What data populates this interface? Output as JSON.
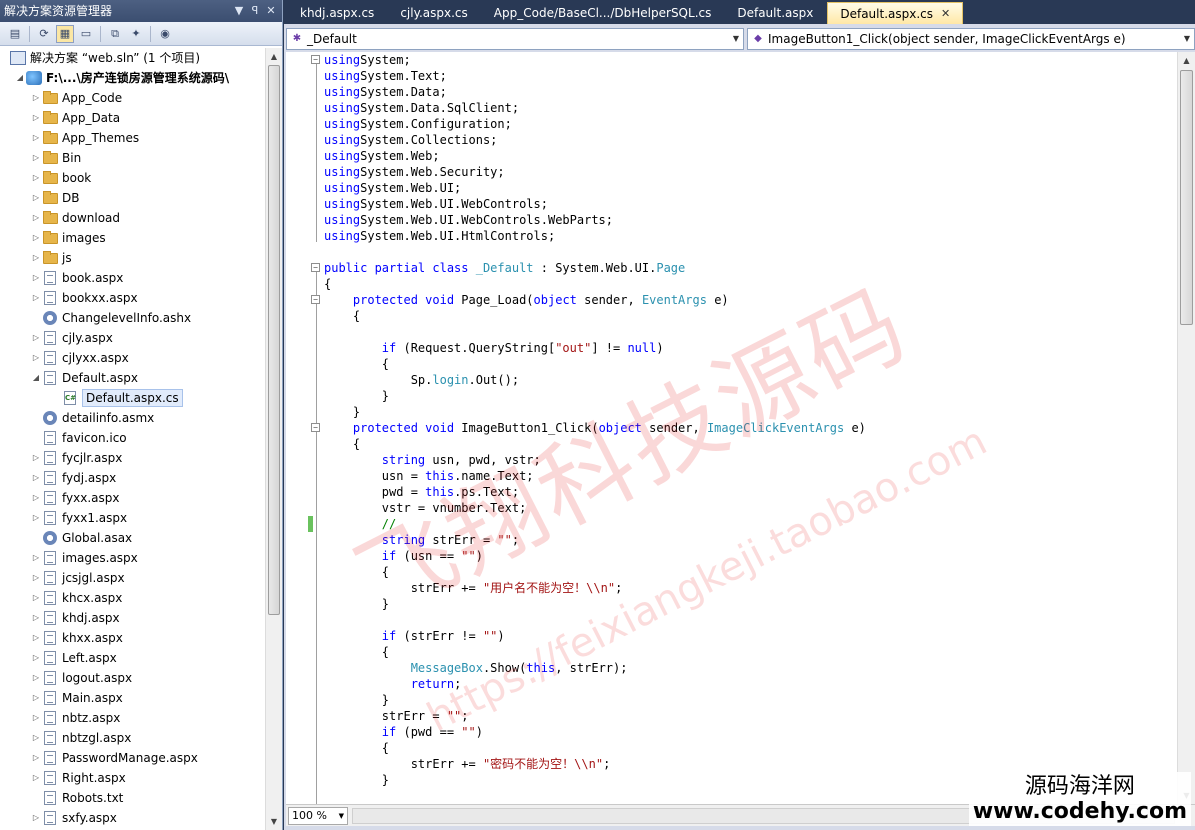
{
  "solution_explorer": {
    "title": "解决方案资源管理器",
    "title_buttons": [
      "▼",
      "ꟼ",
      "✕"
    ],
    "toolbar_icons": [
      "properties-icon",
      "refresh-icon",
      "show-all-files-icon",
      "view-code-icon",
      "copy-website-icon",
      "aspnet-config-icon",
      "class-diagram-icon"
    ],
    "solution_label": "解决方案 “web.sln” (1 个项目)",
    "project_label": "F:\\...\\房产连锁房源管理系统源码\\",
    "items": [
      {
        "label": "App_Code",
        "type": "folder",
        "arrow": "▷"
      },
      {
        "label": "App_Data",
        "type": "folder",
        "arrow": "▷"
      },
      {
        "label": "App_Themes",
        "type": "folder",
        "arrow": "▷"
      },
      {
        "label": "Bin",
        "type": "folder",
        "arrow": "▷"
      },
      {
        "label": "book",
        "type": "folder",
        "arrow": "▷"
      },
      {
        "label": "DB",
        "type": "folder",
        "arrow": "▷"
      },
      {
        "label": "download",
        "type": "folder",
        "arrow": "▷"
      },
      {
        "label": "images",
        "type": "folder",
        "arrow": "▷"
      },
      {
        "label": "js",
        "type": "folder",
        "arrow": "▷"
      },
      {
        "label": "book.aspx",
        "type": "page",
        "arrow": "▷"
      },
      {
        "label": "bookxx.aspx",
        "type": "page",
        "arrow": "▷"
      },
      {
        "label": "ChangelevelInfo.ashx",
        "type": "handler",
        "arrow": ""
      },
      {
        "label": "cjly.aspx",
        "type": "page",
        "arrow": "▷"
      },
      {
        "label": "cjlyxx.aspx",
        "type": "page",
        "arrow": "▷"
      },
      {
        "label": "Default.aspx",
        "type": "page",
        "arrow": "◢"
      },
      {
        "label": "Default.aspx.cs",
        "type": "cs",
        "arrow": "",
        "selected": true,
        "child": true
      },
      {
        "label": "detailinfo.asmx",
        "type": "handler",
        "arrow": ""
      },
      {
        "label": "favicon.ico",
        "type": "page",
        "arrow": ""
      },
      {
        "label": "fycjlr.aspx",
        "type": "page",
        "arrow": "▷"
      },
      {
        "label": "fydj.aspx",
        "type": "page",
        "arrow": "▷"
      },
      {
        "label": "fyxx.aspx",
        "type": "page",
        "arrow": "▷"
      },
      {
        "label": "fyxx1.aspx",
        "type": "page",
        "arrow": "▷"
      },
      {
        "label": "Global.asax",
        "type": "handler",
        "arrow": ""
      },
      {
        "label": "images.aspx",
        "type": "page",
        "arrow": "▷"
      },
      {
        "label": "jcsjgl.aspx",
        "type": "page",
        "arrow": "▷"
      },
      {
        "label": "khcx.aspx",
        "type": "page",
        "arrow": "▷"
      },
      {
        "label": "khdj.aspx",
        "type": "page",
        "arrow": "▷"
      },
      {
        "label": "khxx.aspx",
        "type": "page",
        "arrow": "▷"
      },
      {
        "label": "Left.aspx",
        "type": "page",
        "arrow": "▷"
      },
      {
        "label": "logout.aspx",
        "type": "page",
        "arrow": "▷"
      },
      {
        "label": "Main.aspx",
        "type": "page",
        "arrow": "▷"
      },
      {
        "label": "nbtz.aspx",
        "type": "page",
        "arrow": "▷"
      },
      {
        "label": "nbtzgl.aspx",
        "type": "page",
        "arrow": "▷"
      },
      {
        "label": "PasswordManage.aspx",
        "type": "page",
        "arrow": "▷"
      },
      {
        "label": "Right.aspx",
        "type": "page",
        "arrow": "▷"
      },
      {
        "label": "Robots.txt",
        "type": "page",
        "arrow": ""
      },
      {
        "label": "sxfy.aspx",
        "type": "page",
        "arrow": "▷"
      }
    ]
  },
  "editor": {
    "tabs": [
      {
        "label": "khdj.aspx.cs",
        "active": false
      },
      {
        "label": "cjly.aspx.cs",
        "active": false
      },
      {
        "label": "App_Code/BaseCl.../DbHelperSQL.cs",
        "active": false
      },
      {
        "label": "Default.aspx",
        "active": false
      },
      {
        "label": "Default.aspx.cs",
        "active": true
      }
    ],
    "class_combo": "_Default",
    "member_combo": "ImageButton1_Click(object sender, ImageClickEventArgs e)",
    "zoom": "100 %",
    "code_lines": [
      [
        [
          "kw",
          "using"
        ],
        [
          "",
          "System;"
        ]
      ],
      [
        [
          "kw",
          "using"
        ],
        [
          "",
          "System.Text;"
        ]
      ],
      [
        [
          "kw",
          "using"
        ],
        [
          "",
          "System.Data;"
        ]
      ],
      [
        [
          "kw",
          "using"
        ],
        [
          "",
          "System.Data.SqlClient;"
        ]
      ],
      [
        [
          "kw",
          "using"
        ],
        [
          "",
          "System.Configuration;"
        ]
      ],
      [
        [
          "kw",
          "using"
        ],
        [
          "",
          "System.Collections;"
        ]
      ],
      [
        [
          "kw",
          "using"
        ],
        [
          "",
          "System.Web;"
        ]
      ],
      [
        [
          "kw",
          "using"
        ],
        [
          "",
          "System.Web.Security;"
        ]
      ],
      [
        [
          "kw",
          "using"
        ],
        [
          "",
          "System.Web.UI;"
        ]
      ],
      [
        [
          "kw",
          "using"
        ],
        [
          "",
          "System.Web.UI.WebControls;"
        ]
      ],
      [
        [
          "kw",
          "using"
        ],
        [
          "",
          "System.Web.UI.WebControls.WebParts;"
        ]
      ],
      [
        [
          "kw",
          "using"
        ],
        [
          "",
          "System.Web.UI.HtmlControls;"
        ]
      ],
      [],
      [
        [
          "kw",
          "public partial class"
        ],
        [
          "",
          ""
        ],
        [
          "ty",
          "_Default"
        ],
        [
          "",
          " : System.Web.UI."
        ],
        [
          "ty",
          "Page"
        ]
      ],
      [
        [
          "",
          "{"
        ]
      ],
      [
        [
          "",
          "    "
        ],
        [
          "kw",
          "protected void"
        ],
        [
          "",
          " Page_Load("
        ],
        [
          "kw",
          "object"
        ],
        [
          "",
          " sender, "
        ],
        [
          "ty",
          "EventArgs"
        ],
        [
          "",
          " e)"
        ]
      ],
      [
        [
          "",
          "    {"
        ]
      ],
      [],
      [
        [
          "",
          "        "
        ],
        [
          "kw",
          "if"
        ],
        [
          "",
          " (Request.QueryString["
        ],
        [
          "st",
          "\"out\""
        ],
        [
          "",
          "] != "
        ],
        [
          "kw",
          "null"
        ],
        [
          "",
          ")"
        ]
      ],
      [
        [
          "",
          "        {"
        ]
      ],
      [
        [
          "",
          "            Sp."
        ],
        [
          "ty",
          "login"
        ],
        [
          "",
          ".Out();"
        ]
      ],
      [
        [
          "",
          "        }"
        ]
      ],
      [
        [
          "",
          "    }"
        ]
      ],
      [
        [
          "",
          "    "
        ],
        [
          "kw",
          "protected void"
        ],
        [
          "",
          " ImageButton1_Click("
        ],
        [
          "kw",
          "object"
        ],
        [
          "",
          " sender, "
        ],
        [
          "ty",
          "ImageClickEventArgs"
        ],
        [
          "",
          " e)"
        ]
      ],
      [
        [
          "",
          "    {"
        ]
      ],
      [
        [
          "",
          "        "
        ],
        [
          "kw",
          "string"
        ],
        [
          "",
          " usn, pwd, vstr;"
        ]
      ],
      [
        [
          "",
          "        usn = "
        ],
        [
          "kw",
          "this"
        ],
        [
          "",
          ".name.Text;"
        ]
      ],
      [
        [
          "",
          "        pwd = "
        ],
        [
          "kw",
          "this"
        ],
        [
          "",
          ".ps.Text;"
        ]
      ],
      [
        [
          "",
          "        vstr = vnumber.Text;"
        ]
      ],
      [
        [
          "",
          "        "
        ],
        [
          "cm",
          "//"
        ]
      ],
      [
        [
          "",
          "        "
        ],
        [
          "kw",
          "string"
        ],
        [
          "",
          " strErr = "
        ],
        [
          "st",
          "\"\""
        ],
        [
          "",
          ";"
        ]
      ],
      [
        [
          "",
          "        "
        ],
        [
          "kw",
          "if"
        ],
        [
          "",
          " (usn == "
        ],
        [
          "st",
          "\"\""
        ],
        [
          "",
          ")"
        ]
      ],
      [
        [
          "",
          "        {"
        ]
      ],
      [
        [
          "",
          "            strErr += "
        ],
        [
          "st",
          "\"用户名不能为空！\\\\n\""
        ],
        [
          "",
          ";"
        ]
      ],
      [
        [
          "",
          "        }"
        ]
      ],
      [],
      [
        [
          "",
          "        "
        ],
        [
          "kw",
          "if"
        ],
        [
          "",
          " (strErr != "
        ],
        [
          "st",
          "\"\""
        ],
        [
          "",
          ")"
        ]
      ],
      [
        [
          "",
          "        {"
        ]
      ],
      [
        [
          "",
          "            "
        ],
        [
          "ty",
          "MessageBox"
        ],
        [
          "",
          ".Show("
        ],
        [
          "kw",
          "this"
        ],
        [
          "",
          ", strErr);"
        ]
      ],
      [
        [
          "",
          "            "
        ],
        [
          "kw",
          "return"
        ],
        [
          "",
          ";"
        ]
      ],
      [
        [
          "",
          "        }"
        ]
      ],
      [
        [
          "",
          "        strErr = "
        ],
        [
          "st",
          "\"\""
        ],
        [
          "",
          ";"
        ]
      ],
      [
        [
          "",
          "        "
        ],
        [
          "kw",
          "if"
        ],
        [
          "",
          " (pwd == "
        ],
        [
          "st",
          "\"\""
        ],
        [
          "",
          ")"
        ]
      ],
      [
        [
          "",
          "        {"
        ]
      ],
      [
        [
          "",
          "            strErr += "
        ],
        [
          "st",
          "\"密码不能为空！\\\\n\""
        ],
        [
          "",
          ";"
        ]
      ],
      [
        [
          "",
          "        }"
        ]
      ]
    ]
  },
  "watermark": {
    "big": "飞翔科技源码",
    "url": "https://feixiangkeji.taobao.com",
    "brand_line1": "源码海洋网",
    "brand_line2": "www.codehy.com"
  }
}
